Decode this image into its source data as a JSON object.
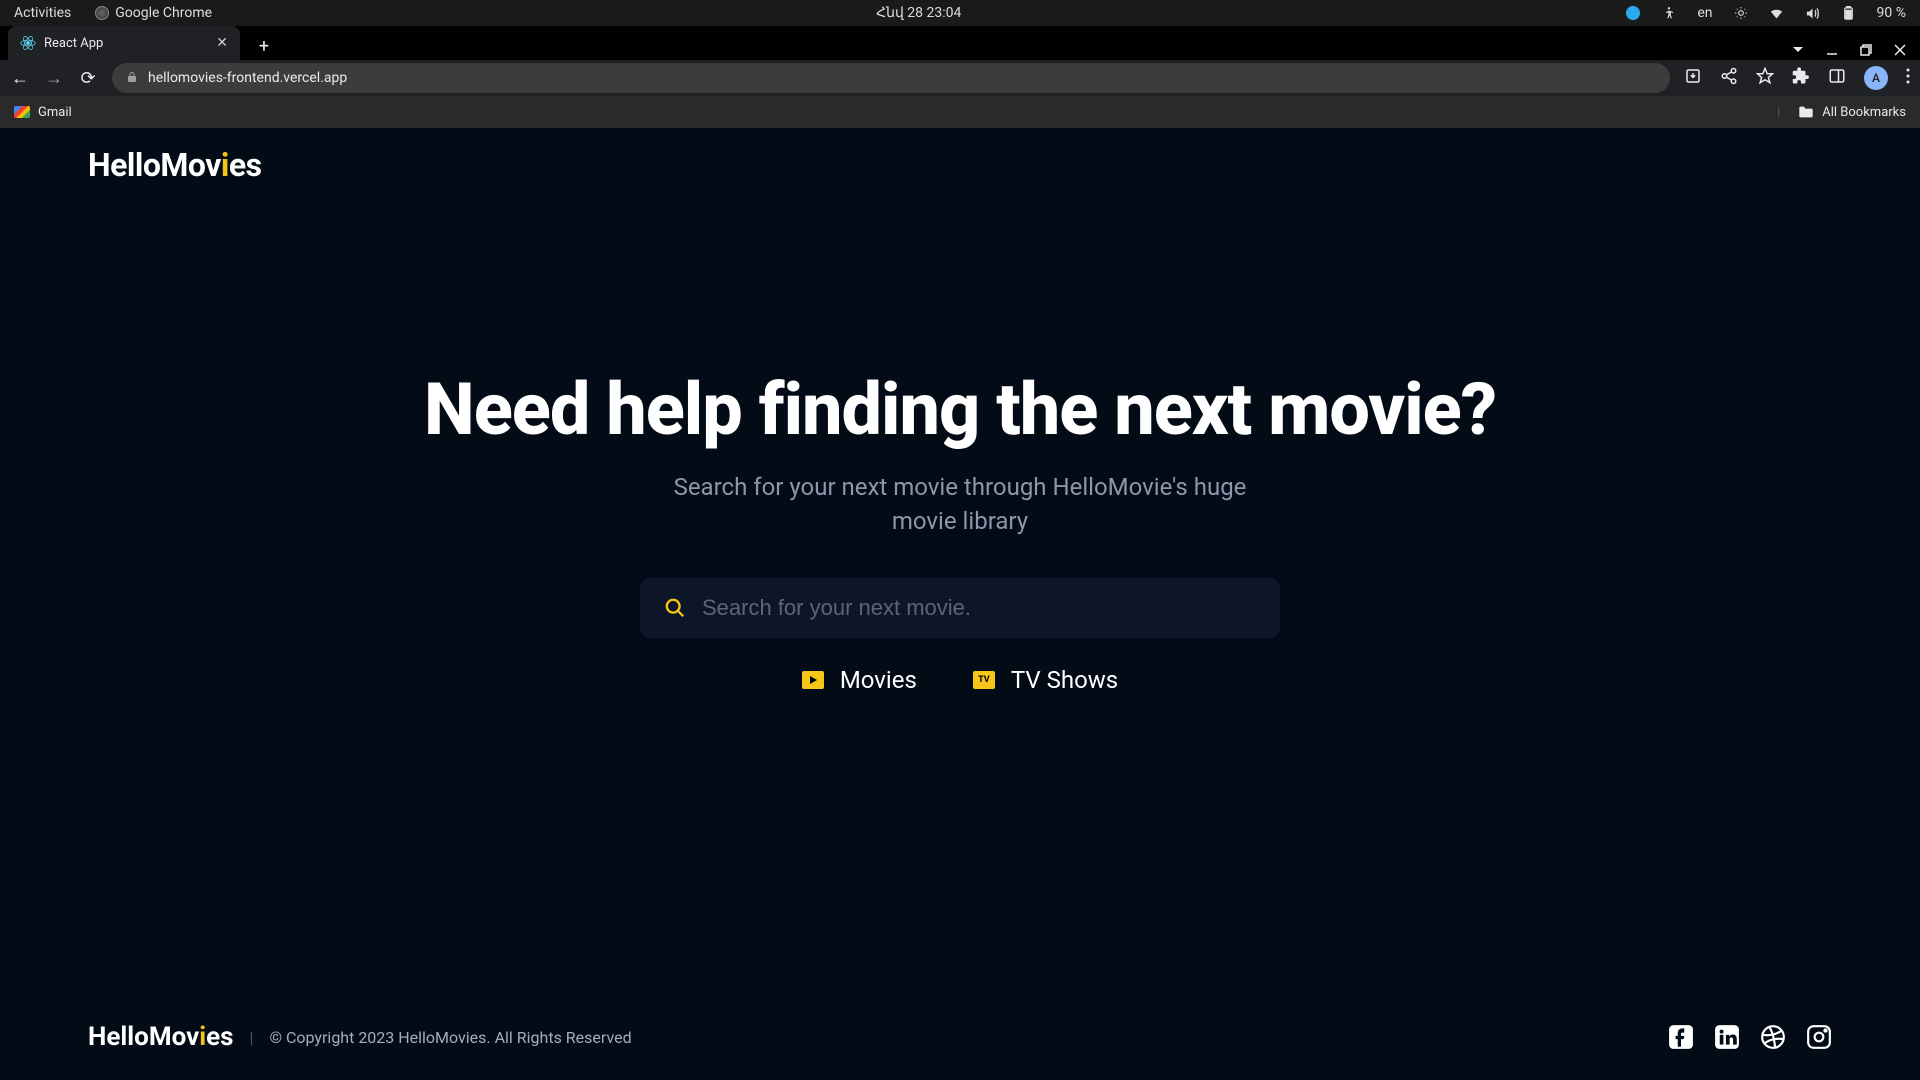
{
  "gnome": {
    "activities": "Activities",
    "app_name": "Google Chrome",
    "datetime": "Հնվ 28  23:04",
    "lang": "en",
    "battery": "90 %"
  },
  "browser": {
    "tab_title": "React App",
    "url": "hellomovies-frontend.vercel.app",
    "bookmark_gmail": "Gmail",
    "all_bookmarks": "All Bookmarks",
    "avatar_letter": "A"
  },
  "app": {
    "logo_prefix": "HelloMov",
    "logo_suffix": "es",
    "hero_title": "Need help finding the next movie?",
    "hero_subtitle": "Search for your next movie through HelloMovie's huge movie library",
    "search_placeholder": "Search for your next movie.",
    "categories": {
      "movies": "Movies",
      "tv_shows": "TV Shows",
      "tv_badge": "TV"
    },
    "copyright": "© Copyright 2023 HelloMovies. All Rights Reserved"
  }
}
